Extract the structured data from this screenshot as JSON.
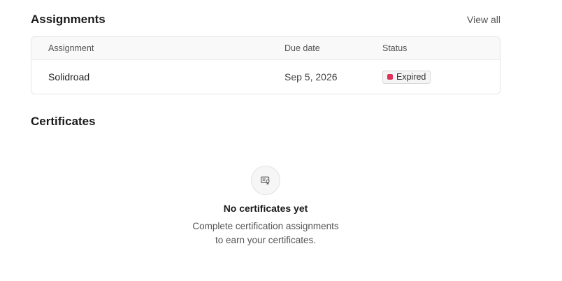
{
  "assignments": {
    "title": "Assignments",
    "view_all_label": "View all",
    "columns": [
      "Assignment",
      "Due date",
      "Status"
    ],
    "rows": [
      {
        "assignment": "Solidroad",
        "due_date": "Sep 5, 2026",
        "status": "Expired"
      }
    ],
    "status_colors": {
      "Expired": "#e0315b"
    }
  },
  "certificates": {
    "title": "Certificates",
    "empty": {
      "icon": "certificate-icon",
      "title": "No certificates yet",
      "description_line1": "Complete certification assignments",
      "description_line2": "to earn your certificates."
    }
  }
}
